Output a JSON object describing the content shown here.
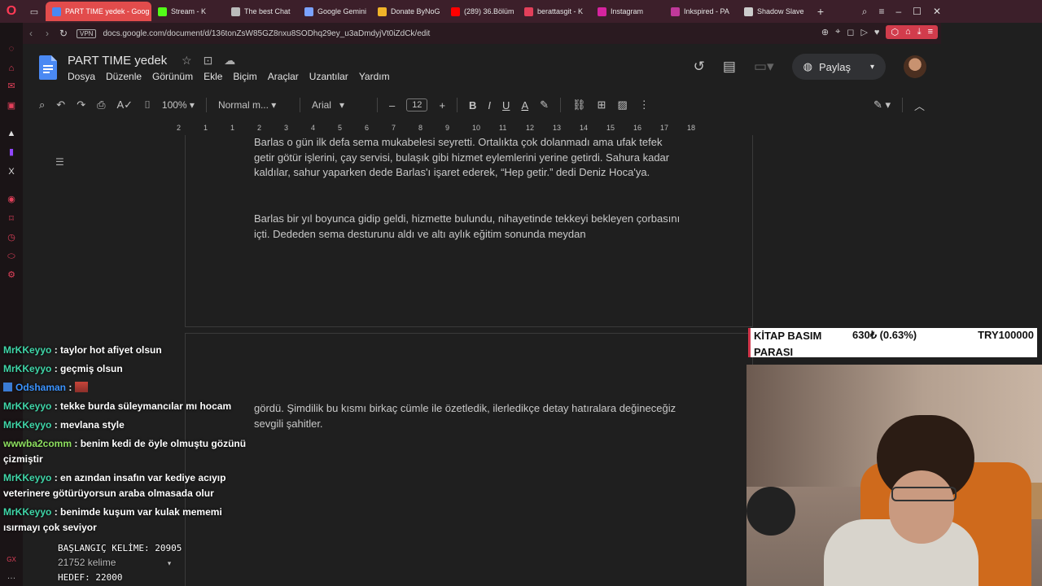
{
  "browser": {
    "tabs": [
      {
        "label": "PART TIME yedek - Goog",
        "active": true,
        "fav": "#4a89f3"
      },
      {
        "label": "Stream - K",
        "fav": "#53fc18"
      },
      {
        "label": "The best Chat",
        "fav": "#bbbbbb"
      },
      {
        "label": "Google Gemini",
        "fav": "#7aa2ff"
      },
      {
        "label": "Donate ByNoG",
        "fav": "#f0b429"
      },
      {
        "label": "(289) 36.Bölüm",
        "fav": "#ff0000"
      },
      {
        "label": "berattasgit - K",
        "fav": "#e2405a"
      },
      {
        "label": "Instagram",
        "fav": "#d6249f"
      },
      {
        "label": "Inkspired - PA",
        "fav": "#c0399a"
      },
      {
        "label": "Shadow Slave",
        "fav": "#cccccc"
      }
    ],
    "vpn": "VPN",
    "url": "docs.google.com/document/d/136tonZsW85GZ8nxu8SODhq29ey_u3aDmdyjVt0iZdCk/edit"
  },
  "docs": {
    "title": "PART TIME  yedek",
    "menu": [
      "Dosya",
      "Düzenle",
      "Görünüm",
      "Ekle",
      "Biçim",
      "Araçlar",
      "Uzantılar",
      "Yardım"
    ],
    "share_label": "Paylaş",
    "zoom": "100%",
    "style": "Normal m...",
    "font": "Arial",
    "font_size": "12",
    "ruler": [
      "2",
      "1",
      "1",
      "2",
      "3",
      "4",
      "5",
      "6",
      "7",
      "8",
      "9",
      "10",
      "11",
      "12",
      "13",
      "14",
      "15",
      "16",
      "17",
      "18"
    ],
    "page1_p1": "Barlas o gün ilk defa sema mukabelesi seyretti. Ortalıkta çok dolanmadı ama ufak tefek getir götür işlerini, çay servisi, bulaşık gibi hizmet eylemlerini yerine getirdi. Sahura kadar kaldılar, sahur yaparken dede Barlas'ı işaret ederek, “Hep getir.” dedi Deniz Hoca'ya.",
    "page1_p2": "Barlas bir yıl boyunca gidip geldi, hizmette bulundu, nihayetinde tekkeyi bekleyen çorbasını içti. Dededen sema desturunu aldı ve altı aylık eğitim sonunda meydan",
    "page2_p1": "gördü. Şimdilik bu kısmı birkaç cümle ile özetledik, ilerledikçe detay hatıralara değineceğiz sevgili şahitler."
  },
  "chat": [
    {
      "user": "MrKKeyyo",
      "text": ": taylor hot afiyet olsun",
      "color": "green"
    },
    {
      "user": "MrKKeyyo",
      "text": ": geçmiş olsun",
      "color": "green"
    },
    {
      "user": "Odshaman",
      "text": ":",
      "color": "blue",
      "badge": true,
      "emote": true
    },
    {
      "user": "MrKKeyyo",
      "text": ": tekke burda süleymancılar mı hocam",
      "color": "green"
    },
    {
      "user": "MrKKeyyo",
      "text": ": mevlana style",
      "color": "green"
    },
    {
      "user": "wwwba2comm",
      "text": ": benim kedi de öyle olmuştu gözünü çizmiştir",
      "color": "lime"
    },
    {
      "user": "MrKKeyyo",
      "text": ": en azından insafın var kediye acıyıp veterinere götürüyorsun araba olmasada olur",
      "color": "green"
    },
    {
      "user": "MrKKeyyo",
      "text": ": benimde kuşum var kulak mememi ısırmayı çok seviyor",
      "color": "green"
    }
  ],
  "counter": {
    "start": "BAŞLANGIÇ KELİME: 20905",
    "current": "21752 kelime",
    "goal": "HEDEF: 22000"
  },
  "donation": {
    "label": "KİTAP BASIM PARASI",
    "amount": "630₺ (0.63%)",
    "goal": "TRY100000",
    "progress_percent": 0.63
  }
}
